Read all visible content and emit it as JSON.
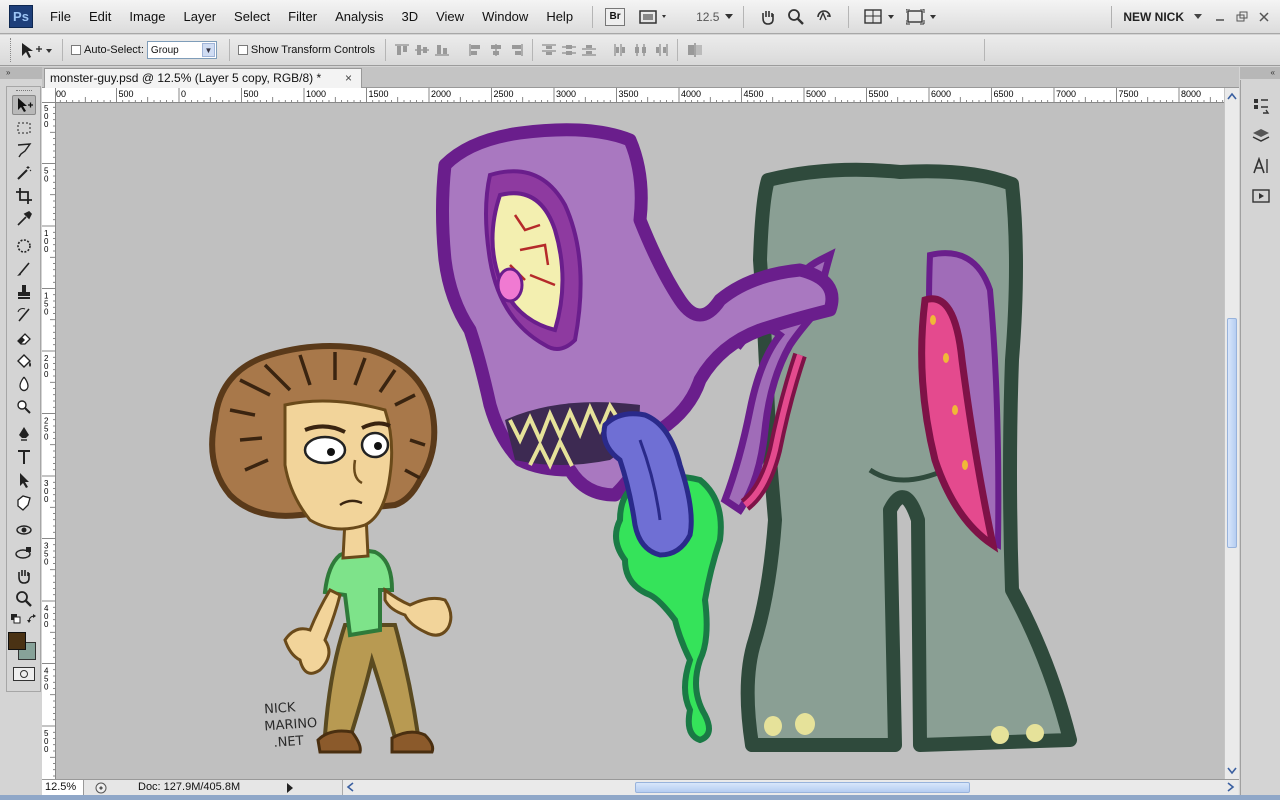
{
  "app": {
    "logo": "Ps",
    "workspace": "NEW NICK"
  },
  "menu": [
    "File",
    "Edit",
    "Image",
    "Layer",
    "Select",
    "Filter",
    "Analysis",
    "3D",
    "View",
    "Window",
    "Help"
  ],
  "menubar": {
    "bridge_label": "Br",
    "zoom_value": "12.5"
  },
  "options": {
    "auto_select_label": "Auto-Select:",
    "auto_select_value": "Group",
    "show_transform_label": "Show Transform Controls"
  },
  "document": {
    "tab_title": "monster-guy.psd @ 12.5% (Layer 5 copy, RGB/8) *",
    "close_glyph": "×"
  },
  "ruler": {
    "h_labels": [
      "00",
      "500",
      "0",
      "500",
      "1000",
      "1500",
      "2000",
      "2500",
      "3000",
      "3500",
      "4000",
      "4500",
      "5000",
      "5500",
      "6000",
      "6500",
      "7000",
      "7500",
      "8000"
    ],
    "v_labels": [
      "5\n0\n0",
      "5\n0",
      "1\n0\n0",
      "1\n5\n0",
      "2\n0\n0",
      "2\n5\n0",
      "3\n0\n0",
      "3\n5\n0",
      "4\n0\n0",
      "4\n5\n0",
      "5\n0\n0",
      "5\n5\n0"
    ]
  },
  "artwork": {
    "signature_line1": "NICK",
    "signature_line2": "MARINO",
    "signature_line3": ".NET"
  },
  "status": {
    "zoom": "12.5%",
    "doc_info": "Doc: 127.9M/405.8M"
  },
  "colors": {
    "foreground": "#4a3214",
    "background": "#87a299",
    "canvas": "#c0c0c0"
  },
  "tools": [
    "move-tool",
    "marquee-tool",
    "lasso-tool",
    "magic-wand-tool",
    "crop-tool",
    "eyedropper-tool",
    "spot-healing-tool",
    "brush-tool",
    "clone-stamp-tool",
    "history-brush-tool",
    "eraser-tool",
    "paint-bucket-tool",
    "dodge-tool",
    "blur-tool",
    "pen-tool",
    "type-tool",
    "path-selection-tool",
    "shape-tool",
    "3d-rotate-tool",
    "3d-orbit-tool",
    "hand-tool",
    "zoom-tool"
  ]
}
